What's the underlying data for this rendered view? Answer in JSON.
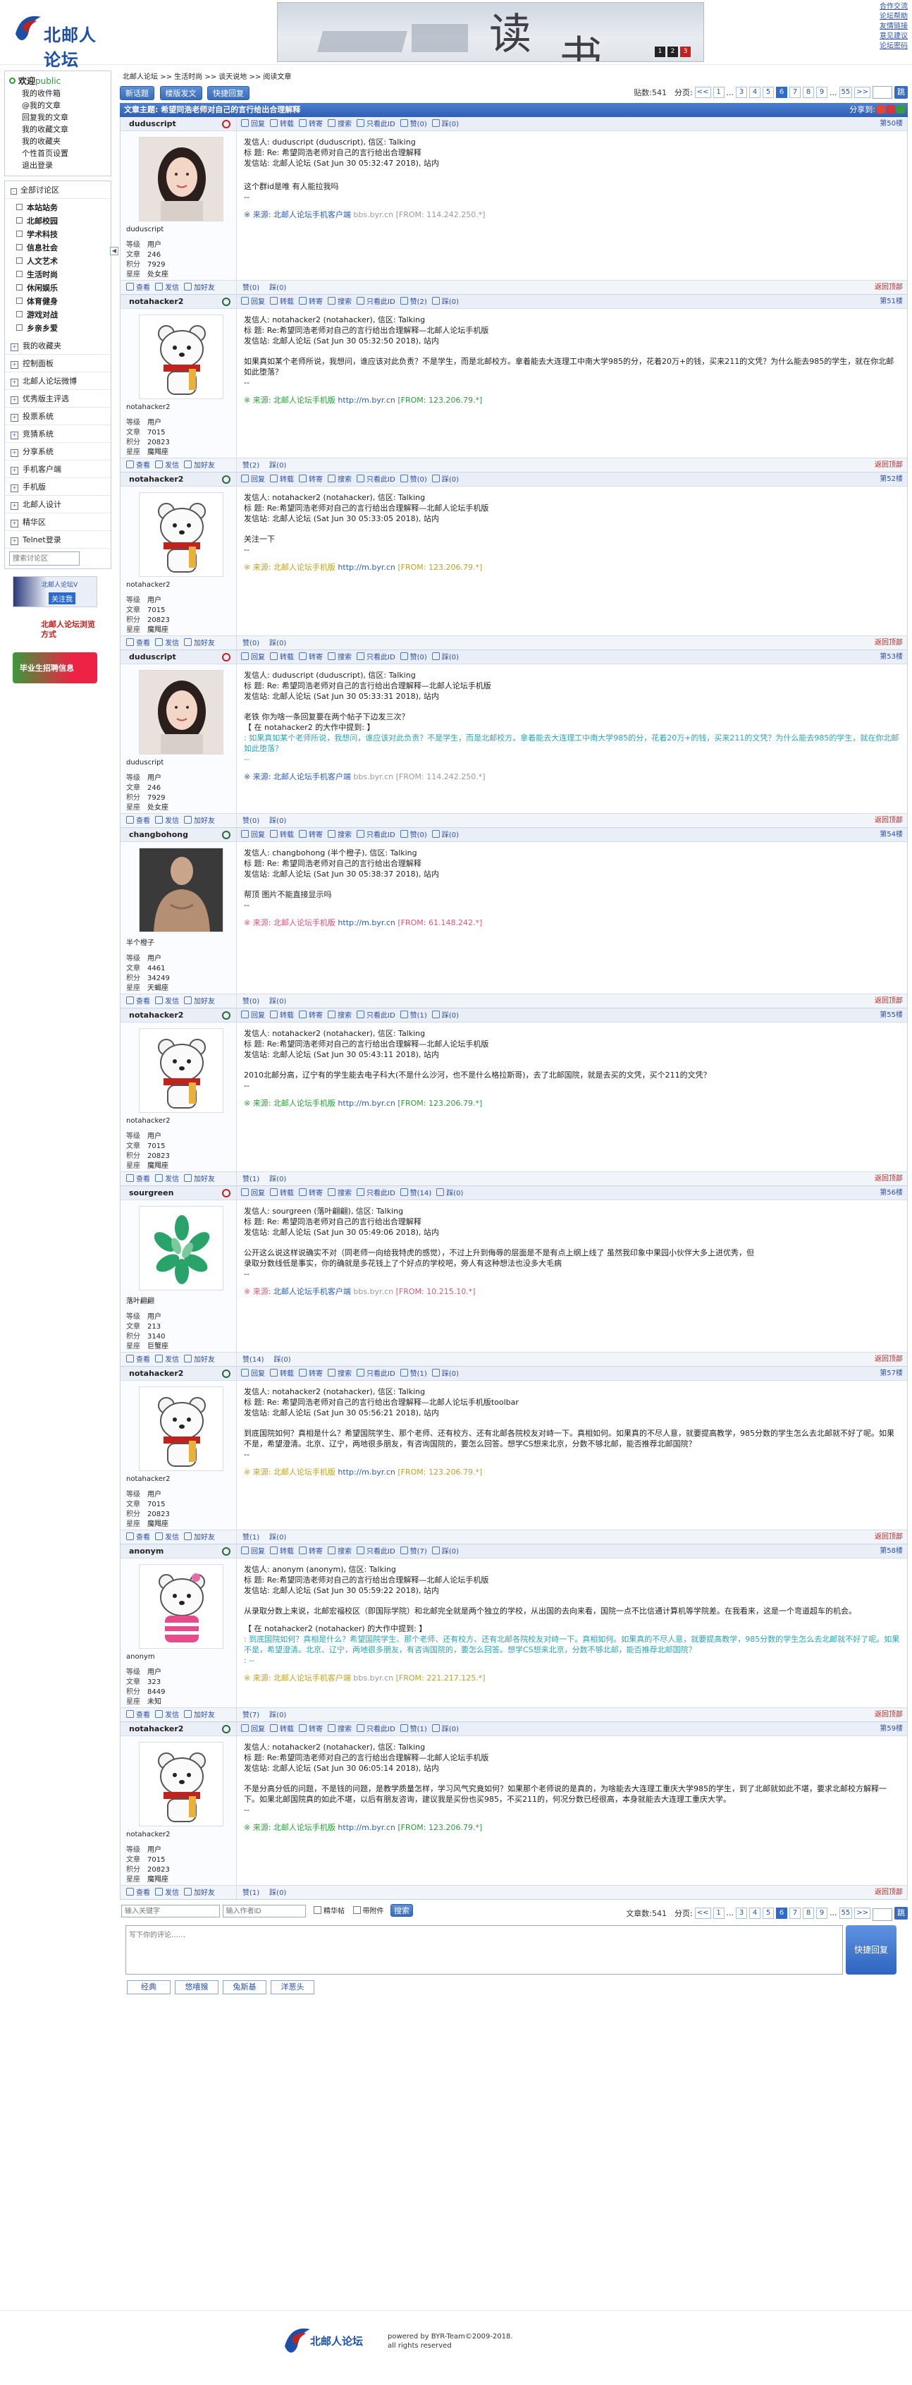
{
  "site": {
    "logo_text": "北邮人论坛",
    "footer_line1": "powered by BYR-Team©2009-2018.",
    "footer_line2": "all rights reserved"
  },
  "banner": {
    "char1": "读",
    "char2": "书",
    "dots": [
      "1",
      "2",
      "3"
    ]
  },
  "toplinks": [
    "合作交流",
    "论坛帮助",
    "友情链接",
    "意见建议",
    "论坛密码"
  ],
  "sidebar": {
    "welcome": "欢迎",
    "user": "public",
    "links": [
      "我的收件箱",
      "@我的文章",
      "回复我的文章",
      "我的收藏文章",
      "我的收藏夹",
      "个性首页设置",
      "退出登录"
    ],
    "all_boards": "全部讨论区",
    "boards": [
      "本站站务",
      "北邮校园",
      "学术科技",
      "信息社会",
      "人文艺术",
      "生活时尚",
      "休闲娱乐",
      "体育健身",
      "游戏对战",
      "乡亲乡爱"
    ],
    "sections": [
      "我的收藏夹",
      "控制面板",
      "北邮人论坛微博",
      "优秀版主评选",
      "投票系统",
      "竞猜系统",
      "分享系统",
      "手机客户端",
      "手机版",
      "北邮人设计",
      "精华区",
      "Telnet登录"
    ],
    "search_placeholder": "搜索讨论区",
    "promo1": "北邮人论坛V",
    "promo1b": "关注我",
    "promo2": "北邮人论坛浏览方式",
    "promo3": "毕业生招聘信息"
  },
  "crumb": [
    "北邮人论坛",
    ">>",
    "生活时尚",
    ">>",
    "谈天说地",
    ">>",
    "阅读文章"
  ],
  "toolbar": {
    "buttons": [
      "新话题",
      "楼版发文",
      "快捷回复"
    ],
    "post_count": "贴数:541",
    "page_label": "分页:",
    "pages": [
      "<<",
      "1",
      "...",
      "3",
      "4",
      "5",
      "6",
      "7",
      "8",
      "9",
      "...",
      "55",
      ">>"
    ],
    "current_page": "6",
    "go": "跳"
  },
  "subject": {
    "title": "文章主题: 希望同浩老师对自己的言行给出合理解释",
    "share": "分享到:"
  },
  "actions": [
    "回复",
    "转载",
    "转寄",
    "搜索",
    "只看此ID",
    "赞(0)",
    "踩(0)"
  ],
  "footer_actions": [
    "查看",
    "发信",
    "加好友"
  ],
  "back_top": "返回顶部",
  "stat_labels": [
    "等级",
    "文章",
    "积分",
    "星座"
  ],
  "posts": [
    {
      "user": "duduscript",
      "gender": "f",
      "floor": "第50楼",
      "avatar": "girl",
      "level": "用户",
      "articles": "246",
      "points": "7929",
      "sign": "处女座",
      "meta": [
        "发信人: duduscript (duduscript), 信区: Talking",
        "标  题: Re: 希望同浩老师对自己的言行给出合理解释",
        "发信站: 北邮人论坛 (Sat Jun 30 05:32:47 2018), 站内"
      ],
      "content": [
        "这个群id是唯 有人能拉我吗",
        "--"
      ],
      "quote": [],
      "src_prefix": "※ 来源: ",
      "src_app": "北邮人论坛手机客户端",
      "src_host": "bbs.byr.cn",
      "src_from": "[FROM: 114.242.250.*]",
      "src_style": "b",
      "likes": "赞(0)",
      "dislikes": "踩(0)",
      "act_likes": "赞(0)",
      "act_dislikes": "踩(0)"
    },
    {
      "user": "notahacker2",
      "gender": "m",
      "floor": "第51楼",
      "avatar": "bear",
      "level": "用户",
      "articles": "7015",
      "points": "20823",
      "sign": "魔羯座",
      "meta": [
        "发信人: notahacker2 (notahacker), 信区: Talking",
        "标  题: Re:希望同浩老师对自己的言行给出合理解释—北邮人论坛手机版",
        "发信站: 北邮人论坛 (Sat Jun 30 05:32:50 2018), 站内"
      ],
      "content": [
        "如果真如某个老师所说，我想问，谁应该对此负责？不是学生，而是北邮校方。拿着能去大连理工中南大学985的分，花着20万+的钱，买来211的文凭？为什么能去985的学生，就在你北邮如此堕落？",
        "--"
      ],
      "quote": [],
      "src_prefix": "※ 来源: 北邮人论坛手机版 ",
      "src_app": "",
      "src_host": "http://m.byr.cn",
      "src_from": "[FROM: 123.206.79.*]",
      "src_style": "m",
      "likes": "赞(2)",
      "dislikes": "踩(0)",
      "act_likes": "赞(2)",
      "act_dislikes": "踩(0)"
    },
    {
      "user": "notahacker2",
      "gender": "m",
      "floor": "第52楼",
      "avatar": "bear",
      "level": "用户",
      "articles": "7015",
      "points": "20823",
      "sign": "魔羯座",
      "meta": [
        "发信人: notahacker2 (notahacker), 信区: Talking",
        "标  题: Re:希望同浩老师对自己的言行给出合理解释—北邮人论坛手机版",
        "发信站: 北邮人论坛 (Sat Jun 30 05:33:05 2018), 站内"
      ],
      "content": [
        "关注一下",
        "--"
      ],
      "quote": [],
      "src_prefix": "※ 来源: 北邮人论坛手机版 ",
      "src_app": "",
      "src_host": "http://m.byr.cn",
      "src_from": "[FROM: 123.206.79.*]",
      "src_style": "y",
      "likes": "赞(0)",
      "dislikes": "踩(0)",
      "act_likes": "赞(0)",
      "act_dislikes": "踩(0)"
    },
    {
      "user": "duduscript",
      "gender": "f",
      "floor": "第53楼",
      "avatar": "girl",
      "level": "用户",
      "articles": "246",
      "points": "7929",
      "sign": "处女座",
      "meta": [
        "发信人: duduscript (duduscript), 信区: Talking",
        "标  题: Re: 希望同浩老师对自己的言行给出合理解释—北邮人论坛手机版",
        "发信站: 北邮人论坛 (Sat Jun 30 05:33:31 2018), 站内"
      ],
      "content": [
        "老铁 你为啥一条回复要在两个帖子下边发三次？",
        "【 在 notahacker2 的大作中提到: 】"
      ],
      "quote": [
        ": 如果真如某个老师所说，我想问，谁应该对此负责？不是学生，而是北邮校方。拿着能去大连理工中南大学985的分，花着20万+的钱，买来211的文凭？为什么能去985的学生，就在你北邮如此堕落？",
        "--"
      ],
      "src_prefix": "※ 来源: ",
      "src_app": "北邮人论坛手机客户端",
      "src_host": "bbs.byr.cn",
      "src_from": "[FROM: 114.242.250.*]",
      "src_style": "b",
      "likes": "赞(0)",
      "dislikes": "踩(0)",
      "act_likes": "赞(0)",
      "act_dislikes": "踩(0)"
    },
    {
      "user": "changbohong",
      "gender": "m",
      "floor": "第54楼",
      "avatar": "man",
      "uid_text": "半个橙子",
      "level": "用户",
      "articles": "4461",
      "points": "34249",
      "sign": "天蝎座",
      "meta": [
        "发信人: changbohong (半个橙子), 信区: Talking",
        "标  题: Re: 希望同浩老师对自己的言行给出合理解释",
        "发信站: 北邮人论坛 (Sat Jun 30 05:38:37 2018), 站内"
      ],
      "content": [
        "帮顶 图片不能直接显示吗",
        "--"
      ],
      "quote": [],
      "src_prefix": "※ 来源: 北邮人论坛手机版 ",
      "src_app": "",
      "src_host": "http://m.byr.cn",
      "src_from": "[FROM: 61.148.242.*]",
      "src_style": "r",
      "likes": "赞(0)",
      "dislikes": "踩(0)",
      "act_likes": "赞(0)",
      "act_dislikes": "踩(0)"
    },
    {
      "user": "notahacker2",
      "gender": "m",
      "floor": "第55楼",
      "avatar": "bear",
      "level": "用户",
      "articles": "7015",
      "points": "20823",
      "sign": "魔羯座",
      "meta": [
        "发信人: notahacker2 (notahacker), 信区: Talking",
        "标  题: Re:希望同浩老师对自己的言行给出合理解释—北邮人论坛手机版",
        "发信站: 北邮人论坛 (Sat Jun 30 05:43:11 2018), 站内"
      ],
      "content": [
        "2010北邮分高，辽宁有的学生能去电子科大(不是什么沙河，也不是什么格拉斯哥)，去了北邮国院，就是去买的文凭，买个211的文凭？",
        "--"
      ],
      "quote": [],
      "src_prefix": "※ 来源: 北邮人论坛手机版 ",
      "src_app": "",
      "src_host": "http://m.byr.cn",
      "src_from": "[FROM: 123.206.79.*]",
      "src_style": "m",
      "likes": "赞(1)",
      "dislikes": "踩(0)",
      "act_likes": "赞(1)",
      "act_dislikes": "踩(0)"
    },
    {
      "user": "sourgreen",
      "gender": "f",
      "floor": "第56楼",
      "avatar": "leaf",
      "uid_text": "落叶翩翩",
      "level": "用户",
      "articles": "213",
      "points": "3140",
      "sign": "巨蟹座",
      "meta": [
        "发信人: sourgreen (落叶翩翩), 信区: Talking",
        "标  题: Re: 希望同浩老师对自己的言行给出合理解释",
        "发信站: 北邮人论坛 (Sat Jun 30 05:49:06 2018), 站内"
      ],
      "content": [
        "公开这么说这样说确实不对（同老师一向给我特虎的感觉），不过上升到侮辱的层面是不是有点上纲上线了 虽然我印象中果园小伙伴大多上进优秀，但",
        "录取分数线低是事实，你的确就是多花钱上了个好点的学校吧，旁人有这种想法也没多大毛病",
        "--"
      ],
      "quote": [],
      "src_prefix": "※ 来源: ",
      "src_app": "北邮人论坛手机客户端",
      "src_host": "bbs.byr.cn",
      "src_from": "[FROM: 10.215.10.*]",
      "src_style": "r",
      "likes": "赞(14)",
      "dislikes": "踩(0)",
      "act_likes": "赞(14)",
      "act_dislikes": "踩(0)"
    },
    {
      "user": "notahacker2",
      "gender": "m",
      "floor": "第57楼",
      "avatar": "bear",
      "level": "用户",
      "articles": "7015",
      "points": "20823",
      "sign": "魔羯座",
      "meta": [
        "发信人: notahacker2 (notahacker), 信区: Talking",
        "标  题: Re: 希望同浩老师对自己的言行给出合理解释—北邮人论坛手机版toolbar",
        "发信站: 北邮人论坛 (Sat Jun 30 05:56:21 2018), 站内"
      ],
      "content": [
        "到底国院如何？真相是什么？希望国院学生、那个老师、还有校方、还有北邮各院校友对峙一下。真相如何。如果真的不尽人意，就要提高教学，985分数的学生怎么去北邮就不好了呢。如果不是，希望澄清。北京、辽宁，两地很多朋友，有咨询国院的，要怎么回答。想学CS想来北京，分数不够北邮，能否推荐北邮国院？",
        "--"
      ],
      "quote": [],
      "src_prefix": "※ 来源: 北邮人论坛手机版 ",
      "src_app": "",
      "src_host": "http://m.byr.cn",
      "src_from": "[FROM: 123.206.79.*]",
      "src_style": "y",
      "likes": "赞(1)",
      "dislikes": "踩(0)",
      "act_likes": "赞(1)",
      "act_dislikes": "踩(0)"
    },
    {
      "user": "anonym",
      "gender": "m",
      "floor": "第58楼",
      "avatar": "bear2",
      "level": "用户",
      "articles": "323",
      "points": "8449",
      "sign": "未知",
      "meta": [
        "发信人: anonym (anonym), 信区: Talking",
        "标  题: Re:希望同浩老师对自己的言行给出合理解释—北邮人论坛手机版",
        "发信站: 北邮人论坛 (Sat Jun 30 05:59:22 2018), 站内"
      ],
      "content": [
        "从录取分数上来说，北邮宏福校区（即国际学院）和北邮完全就是两个独立的学校，从出国的去向来看，国院一点不比信通计算机等学院差。在我看来，这是一个弯道超车的机会。",
        "",
        "【 在 notahacker2 (notahacker) 的大作中提到: 】"
      ],
      "quote": [
        ": 到底国院如何？真相是什么？希望国院学生、那个老师、还有校方、还有北邮各院校友对峙一下。真相如何。如果真的不尽人意，就要提高教学，985分数的学生怎么去北邮就不好了呢。如果不是，希望澄清。北京、辽宁，两地很多朋友，有咨询国院的，要怎么回答。想学CS想来北京，分数不够北邮，能否推荐北邮国院？",
        ": --"
      ],
      "src_prefix": "※ 来源: 北邮人论坛手机客户端 ",
      "src_app": "",
      "src_host": "bbs.byr.cn",
      "src_from": "[FROM: 221.217.125.*]",
      "src_style": "y",
      "likes": "赞(7)",
      "dislikes": "踩(0)",
      "act_likes": "赞(7)",
      "act_dislikes": "踩(0)"
    },
    {
      "user": "notahacker2",
      "gender": "m",
      "floor": "第59楼",
      "avatar": "bear",
      "level": "用户",
      "articles": "7015",
      "points": "20823",
      "sign": "魔羯座",
      "meta": [
        "发信人: notahacker2 (notahacker), 信区: Talking",
        "标  题: Re:希望同浩老师对自己的言行给出合理解释—北邮人论坛手机版",
        "发信站: 北邮人论坛 (Sat Jun 30 06:05:14 2018), 站内"
      ],
      "content": [
        "不是分高分低的问题，不是钱的问题，是教学质量怎样，学习风气究竟如何？如果那个老师说的是真的，为啥能去大连理工重庆大学985的学生，到了北邮就如此不堪，要求北邮校方解释一下。如果北邮国院真的如此不堪，以后有朋友咨询，建议我是买份也买985，不买211的，何况分数已经很高，本身就能去大连理工重庆大学。",
        "--"
      ],
      "quote": [],
      "src_prefix": "※ 来源: 北邮人论坛手机版 ",
      "src_app": "",
      "src_host": "http://m.byr.cn",
      "src_from": "[FROM: 123.206.79.*]",
      "src_style": "m",
      "likes": "赞(1)",
      "dislikes": "踩(0)",
      "act_likes": "赞(1)",
      "act_dislikes": "踩(0)"
    }
  ],
  "bottom": {
    "kw_placeholder": "输入关键字",
    "author_placeholder": "输入作者ID",
    "chk1": "精华帖",
    "chk2": "带附件",
    "search": "搜索",
    "article_count": "文章数:541",
    "reply_placeholder": "写下你的评论……",
    "send": "快捷回复",
    "emos": [
      "经典",
      "悠嘻猴",
      "兔斯基",
      "洋葱头"
    ]
  }
}
